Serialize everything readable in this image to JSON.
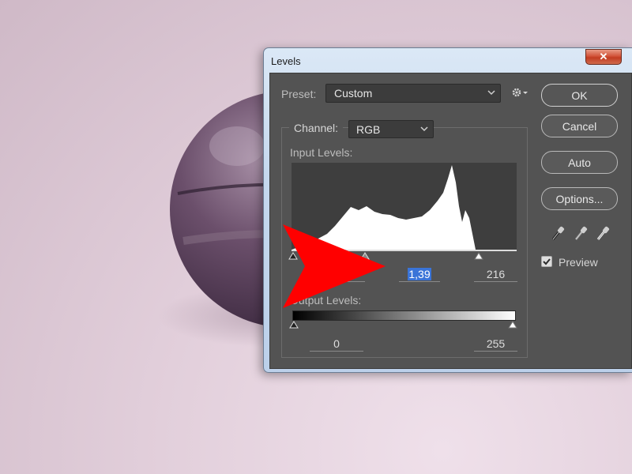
{
  "window": {
    "title": "Levels",
    "close_glyph": "✕"
  },
  "preset": {
    "label": "Preset:",
    "value": "Custom"
  },
  "channel": {
    "label": "Channel:",
    "value": "RGB"
  },
  "input_levels": {
    "label": "Input Levels:",
    "black": "",
    "gamma": "1,39",
    "white": "216"
  },
  "output_levels": {
    "label": "Output Levels:",
    "black": "0",
    "white": "255"
  },
  "buttons": {
    "ok": "OK",
    "cancel": "Cancel",
    "auto": "Auto",
    "options": "Options..."
  },
  "preview": {
    "label": "Preview",
    "checked": true
  },
  "icons": [
    "gear-icon",
    "chevron-down-icon",
    "eyedropper-black-icon",
    "eyedropper-gray-icon",
    "eyedropper-white-icon",
    "close-icon",
    "checkmark-icon"
  ],
  "colors": {
    "dialog_bg": "#535353",
    "field_bg": "#3c3c3c",
    "selection": "#3a74d8",
    "close_button": "#c23c22",
    "annotation_arrow": "#ff0000"
  }
}
